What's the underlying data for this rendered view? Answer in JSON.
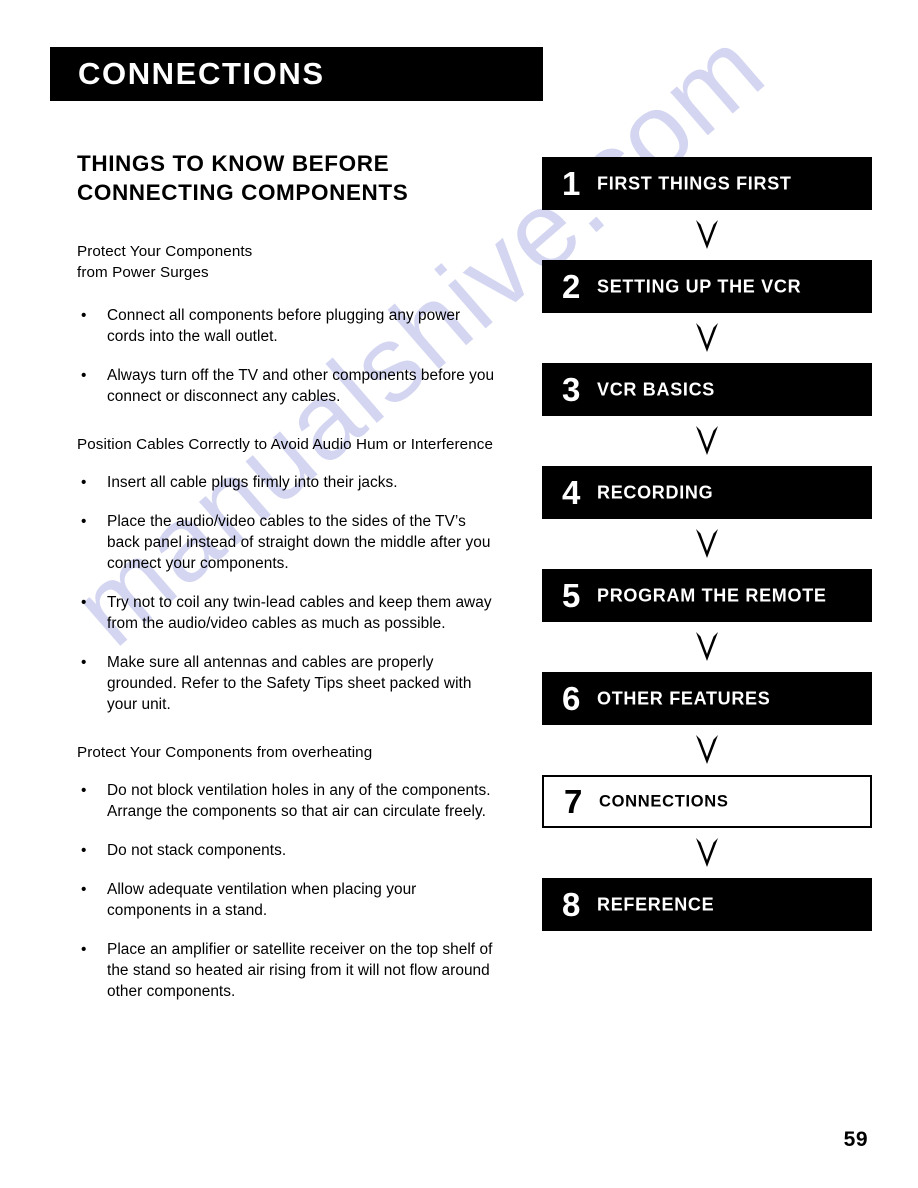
{
  "header": {
    "title": "CONNECTIONS"
  },
  "main": {
    "section_title_line1": "THINGS TO KNOW BEFORE",
    "section_title_line2": "CONNECTING COMPONENTS",
    "subhead_1_line1": "Protect Your Components",
    "subhead_1_line2": "from Power Surges",
    "bullets_1": [
      "Connect all components before plugging any power cords into the wall outlet.",
      "Always turn off the TV and other components before you connect or disconnect any cables."
    ],
    "subhead_2": "Position Cables Correctly to Avoid Audio Hum or Interference",
    "bullets_2": [
      "Insert all cable plugs firmly into their jacks.",
      "Place the audio/video cables to the sides of the TV’s back panel instead of straight down the middle after you connect your components.",
      "Try not to coil any twin-lead cables and keep them away from the audio/video cables as much as possible.",
      "Make sure all antennas and cables are properly grounded. Refer to the Safety Tips sheet packed with your unit."
    ],
    "subhead_3": "Protect Your Components from overheating",
    "bullets_3": [
      "Do not block ventilation holes in any of the components.  Arrange the components so that air can circulate freely.",
      "Do not stack components.",
      "Allow adequate ventilation when placing your components in a stand.",
      "Place an amplifier or satellite receiver on the top shelf of the stand so heated air rising from it will not flow around other components."
    ],
    "bullet_glyph": "•"
  },
  "nav": {
    "items": [
      {
        "number": "1",
        "label": "FIRST THINGS FIRST",
        "active": false
      },
      {
        "number": "2",
        "label": "SETTING UP THE VCR",
        "active": false
      },
      {
        "number": "3",
        "label": "VCR BASICS",
        "active": false
      },
      {
        "number": "4",
        "label": "RECORDING",
        "active": false
      },
      {
        "number": "5",
        "label": "PROGRAM THE REMOTE",
        "active": false
      },
      {
        "number": "6",
        "label": "OTHER FEATURES",
        "active": false
      },
      {
        "number": "7",
        "label": "CONNECTIONS",
        "active": true
      },
      {
        "number": "8",
        "label": "REFERENCE",
        "active": false
      }
    ]
  },
  "footer": {
    "page_number": "59"
  },
  "watermark": {
    "text": "manualshive.com",
    "color": "#cdd0ef"
  },
  "colors": {
    "banner_background": "#000000",
    "banner_text": "#ffffff",
    "page_background": "#ffffff",
    "body_text": "#000000"
  }
}
